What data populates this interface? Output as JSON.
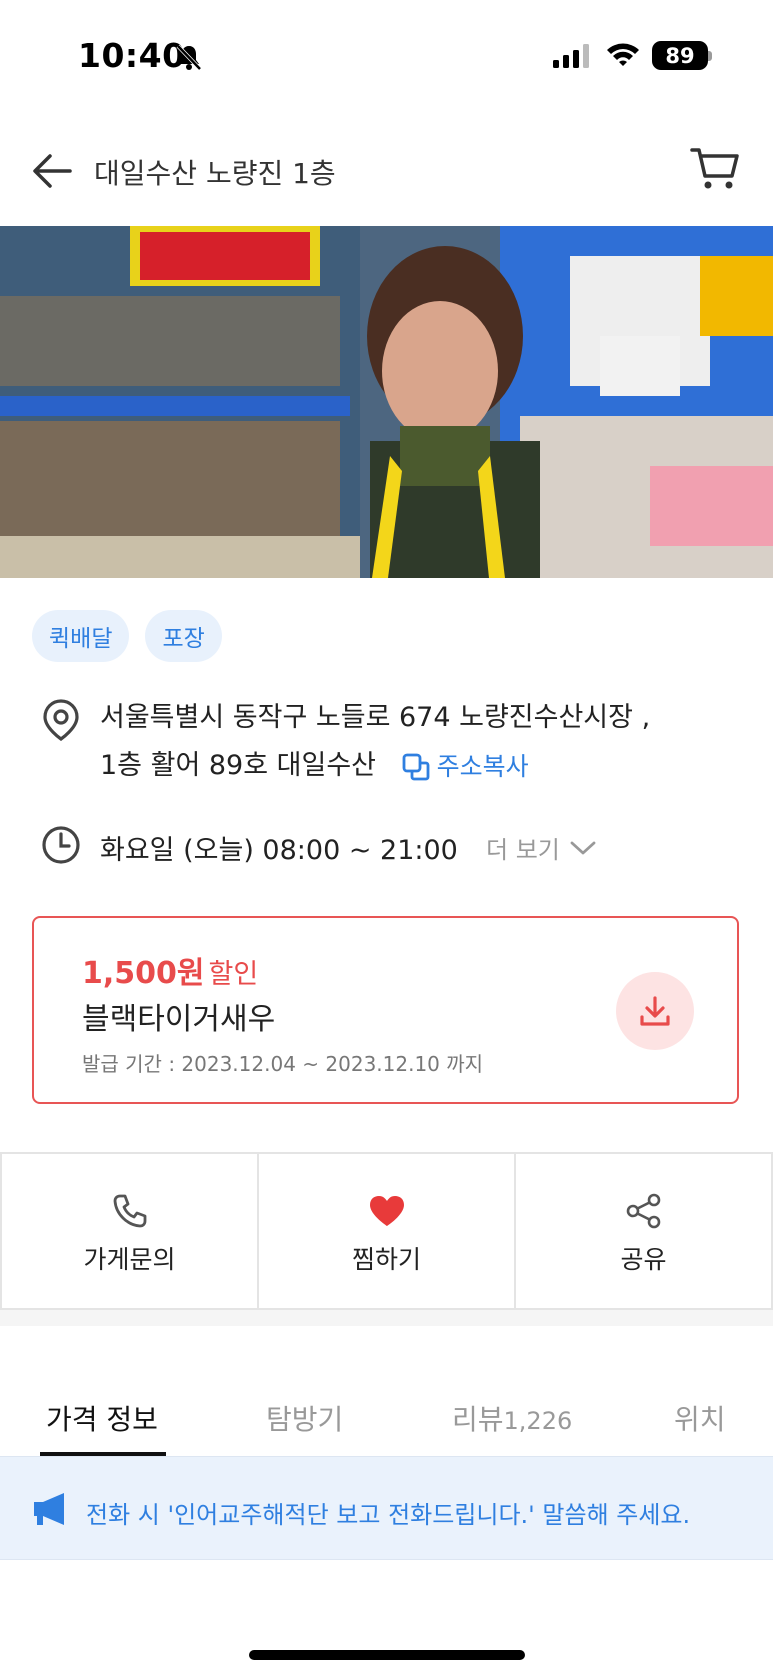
{
  "status_bar": {
    "time": "10:40",
    "battery": "89"
  },
  "header": {
    "title": "대일수산 노량진 1층"
  },
  "tags": [
    "퀵배달",
    "포장"
  ],
  "info": {
    "address_line1": "서울특별시 동작구 노들로 674 노량진수산시장 ,",
    "address_line2": "1층 활어 89호 대일수산",
    "copy_address_label": "주소복사",
    "hours": "화요일 (오늘) 08:00 ~ 21:00",
    "more_label": "더 보기"
  },
  "coupon": {
    "amount": "1,500원",
    "amount_suffix": "할인",
    "name": "블랙타이거새우",
    "period": "발급 기간 : 2023.12.04 ~ 2023.12.10 까지"
  },
  "actions": {
    "inquiry": "가게문의",
    "favorite": "찜하기",
    "share": "공유"
  },
  "tabs": {
    "price": "가격 정보",
    "visit": "탐방기",
    "review": "리뷰",
    "review_count": "1,226",
    "location": "위치"
  },
  "notice": {
    "text": "전화 시 '인어교주해적단 보고 전화드립니다.' 말씀해 주세요."
  },
  "colors": {
    "accent_blue": "#2f7fe0",
    "coupon_red": "#e84b4b",
    "heart_red": "#e83a3a"
  }
}
